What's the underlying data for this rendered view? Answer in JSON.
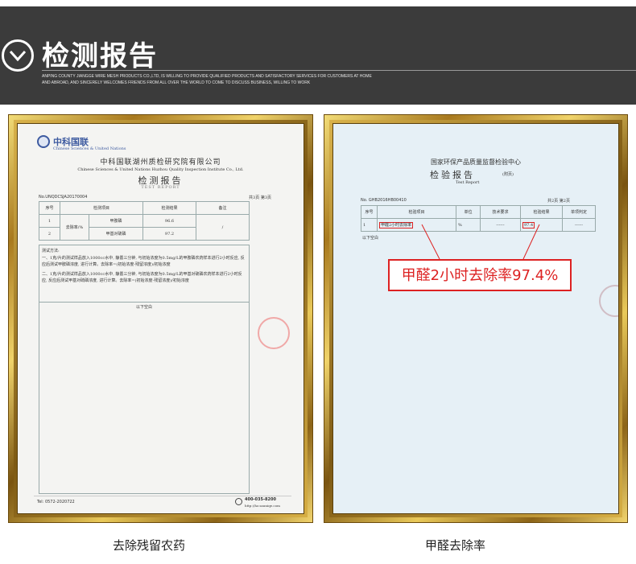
{
  "header": {
    "title": "检测报告",
    "subtitle_line1": "ANPING COUNTY JIANGGE WIRE MESH PRODUCTS CO.,LTD, IS WILLING TO PROVIDE QUALIFIED PRODUCTS AND SATISFACTORY SERVICES FOR CUSTOMERS AT HOME",
    "subtitle_line2": "AND ABROAD, AND SINCERELY WELCOMES FRIENDS FROM ALL OVER THE WORLD TO COME TO DISCUSS BUSINESS, WILLING TO WORK"
  },
  "left_report": {
    "logo_text": "中科国联",
    "logo_sub": "Chinese Sciences & United Nations",
    "institute": "中科国联湖州质检研究院有限公司",
    "institute_en": "Chinese Sciences & United Nations Huzhou Quality Inspection Institute Co., Ltd.",
    "doc_title": "检测报告",
    "doc_title_en": "TEST REPORT",
    "report_no": "No.UNQDCSJA20170004",
    "page_info": "共3页 第3页",
    "table_headers": [
      "序号",
      "检测项目",
      "检测结果",
      "备注"
    ],
    "rows": [
      {
        "no": "1",
        "group": "去除率/%",
        "item": "甲胺磷",
        "result": "96.6",
        "note": "/"
      },
      {
        "no": "2",
        "group": "",
        "item": "甲基对硫磷",
        "result": "97.2",
        "note": ""
      }
    ],
    "method_title": "测试方法:",
    "method_1": "一、1克/片的测试样品放入1000cc水中, 静置三分钟, 与初始浓度为0.5mg/L的甲胺磷农药样本进行2小时反应, 反应后测试甲胺磷浓度, 进行计算。去除率=(初始浓度-残留浓度)/初始浓度",
    "method_2": "二、1克/片的测试样品放入1000cc水中, 静置三分钟, 与初始浓度为0.5mg/L的甲基对硫磷农药样本进行2小时反应, 反应后测试甲基对硫磷浓度, 进行计算。去除率=(初始浓度-残留浓度)/初始浓度",
    "blank_text": "以下空白",
    "tel": "Tel: 0572-2020722",
    "hotline": "400-035-8200",
    "website": "http://hz.sauniqe.com"
  },
  "right_report": {
    "center": "国家环保产品质量监督检验中心",
    "doc_title": "检验报告",
    "attach": "(附页)",
    "doc_title_en": "Test      Report",
    "report_no": "No. GHB2016HB00410",
    "page_info": "共2页  第2页",
    "table_headers": [
      "序号",
      "检验项目",
      "单位",
      "技术要求",
      "检验结果",
      "单项判定"
    ],
    "row": {
      "no": "1",
      "item": "甲醛2小时去除率",
      "unit": "%",
      "requirement": "------",
      "result": "97.4",
      "judgement": "------"
    },
    "blank_text": "以下空白",
    "callout": "甲醛2小时去除率97.4%"
  },
  "captions": {
    "left": "去除残留农药",
    "right": "甲醛去除率"
  },
  "colors": {
    "banner": "#3b3b3b",
    "callout_red": "#d22222",
    "frame_gold": "#c9a13a"
  }
}
